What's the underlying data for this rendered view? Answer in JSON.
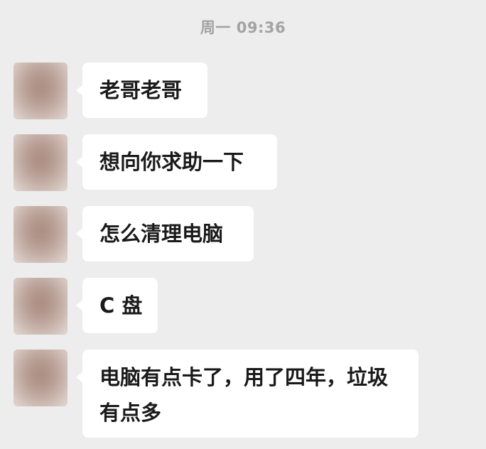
{
  "timestamp": "周一 09:36",
  "messages": [
    {
      "text": "老哥老哥",
      "avatar_icon": "blurred-avatar"
    },
    {
      "text": "想向你求助一下",
      "avatar_icon": "blurred-avatar"
    },
    {
      "text": "怎么清理电脑",
      "avatar_icon": "blurred-avatar"
    },
    {
      "text": "C 盘",
      "avatar_icon": "blurred-avatar"
    },
    {
      "text": "电脑有点卡了，用了四年，垃圾有点多",
      "avatar_icon": "blurred-avatar"
    }
  ],
  "colors": {
    "background": "#ededed",
    "bubble": "#ffffff",
    "text": "#1a1a1a",
    "timestamp": "#a3a3a3"
  }
}
